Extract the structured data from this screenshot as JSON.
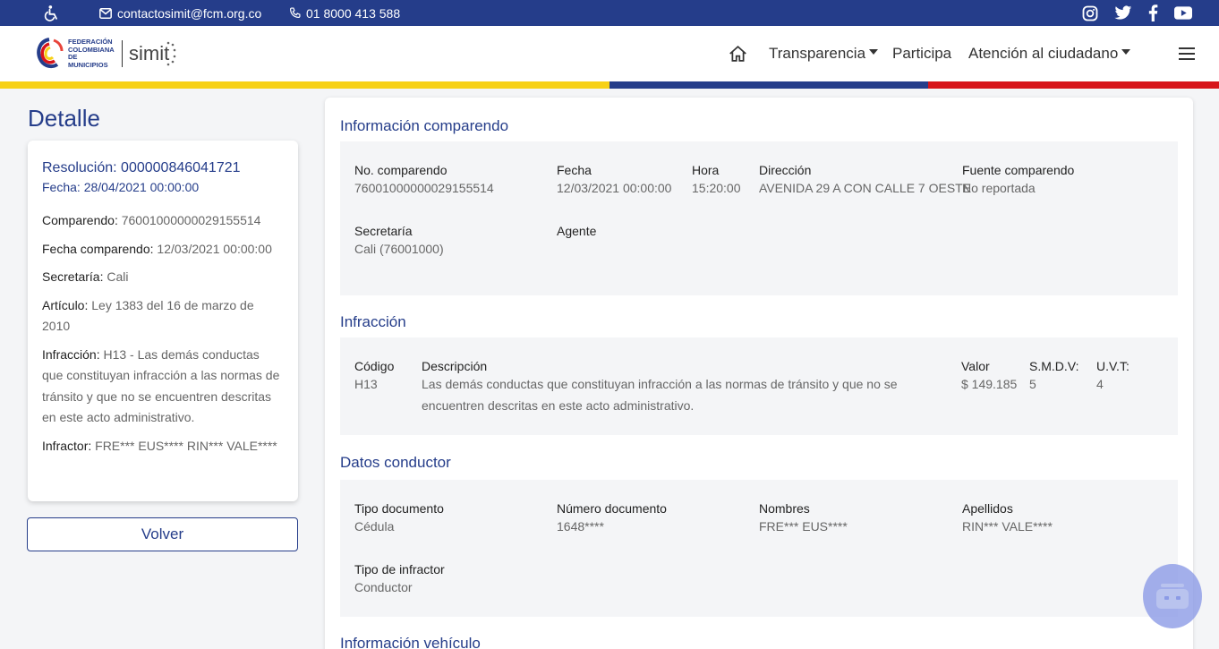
{
  "topbar": {
    "email": "contactosimit@fcm.org.co",
    "phone": "01 8000 413 588",
    "icons": [
      "accessibility-icon",
      "mail-icon",
      "phone-icon",
      "instagram-icon",
      "twitter-icon",
      "facebook-icon",
      "youtube-icon"
    ]
  },
  "header": {
    "logo_text": "FEDERACIÓN COLOMBIANA DE MUNICIPIOS",
    "logo_brand": "simit",
    "nav": {
      "transparencia": "Transparencia",
      "participa": "Participa",
      "atencion": "Atención al ciudadano"
    },
    "flag_colors": [
      "#f7d117",
      "#253d8a",
      "#d7141a"
    ]
  },
  "left": {
    "title": "Detalle",
    "resolucion": "Resolución: 000000846041721",
    "fecha": "Fecha: 28/04/2021 00:00:00",
    "rows": [
      {
        "label": "Comparendo:",
        "value": "76001000000029155514"
      },
      {
        "label": "Fecha comparendo:",
        "value": "12/03/2021 00:00:00"
      },
      {
        "label": "Secretaría:",
        "value": "Cali"
      },
      {
        "label": "Artículo:",
        "value": "Ley 1383 del 16 de marzo de 2010"
      },
      {
        "label": "Infracción:",
        "value": "H13 - Las demás conductas que constituyan infracción a las normas de tránsito y que no se encuentren descritas en este acto administrativo."
      },
      {
        "label": "Infractor:",
        "value": "FRE*** EUS**** RIN*** VALE****"
      }
    ],
    "volver": "Volver"
  },
  "info_comparendo": {
    "title": "Información comparendo",
    "no_comparendo": {
      "label": "No. comparendo",
      "value": "76001000000029155514"
    },
    "fecha": {
      "label": "Fecha",
      "value": "12/03/2021 00:00:00"
    },
    "hora": {
      "label": "Hora",
      "value": "15:20:00"
    },
    "direccion": {
      "label": "Dirección",
      "value": "AVENIDA 29 A CON CALLE 7 OESTE"
    },
    "fuente": {
      "label": "Fuente comparendo",
      "value": "No reportada"
    },
    "secretaria": {
      "label": "Secretaría",
      "value": "Cali (76001000)"
    },
    "agente": {
      "label": "Agente",
      "value": ""
    }
  },
  "infraccion": {
    "title": "Infracción",
    "codigo": {
      "label": "Código",
      "value": "H13"
    },
    "descripcion": {
      "label": "Descripción",
      "value": "Las demás conductas que constituyan infracción a las normas de tránsito y que no se encuentren descritas en este acto administrativo."
    },
    "valor": {
      "label": "Valor",
      "value": "$ 149.185"
    },
    "smdv": {
      "label": "S.M.D.V:",
      "value": "5"
    },
    "uvt": {
      "label": "U.V.T:",
      "value": "4"
    }
  },
  "conductor": {
    "title": "Datos conductor",
    "tipo_documento": {
      "label": "Tipo documento",
      "value": "Cédula"
    },
    "numero_documento": {
      "label": "Número documento",
      "value": "1648****"
    },
    "nombres": {
      "label": "Nombres",
      "value": "FRE*** EUS****"
    },
    "apellidos": {
      "label": "Apellidos",
      "value": "RIN*** VALE****"
    },
    "tipo_infractor": {
      "label": "Tipo de infractor",
      "value": "Conductor"
    }
  },
  "vehiculo": {
    "title": "Información vehículo"
  }
}
